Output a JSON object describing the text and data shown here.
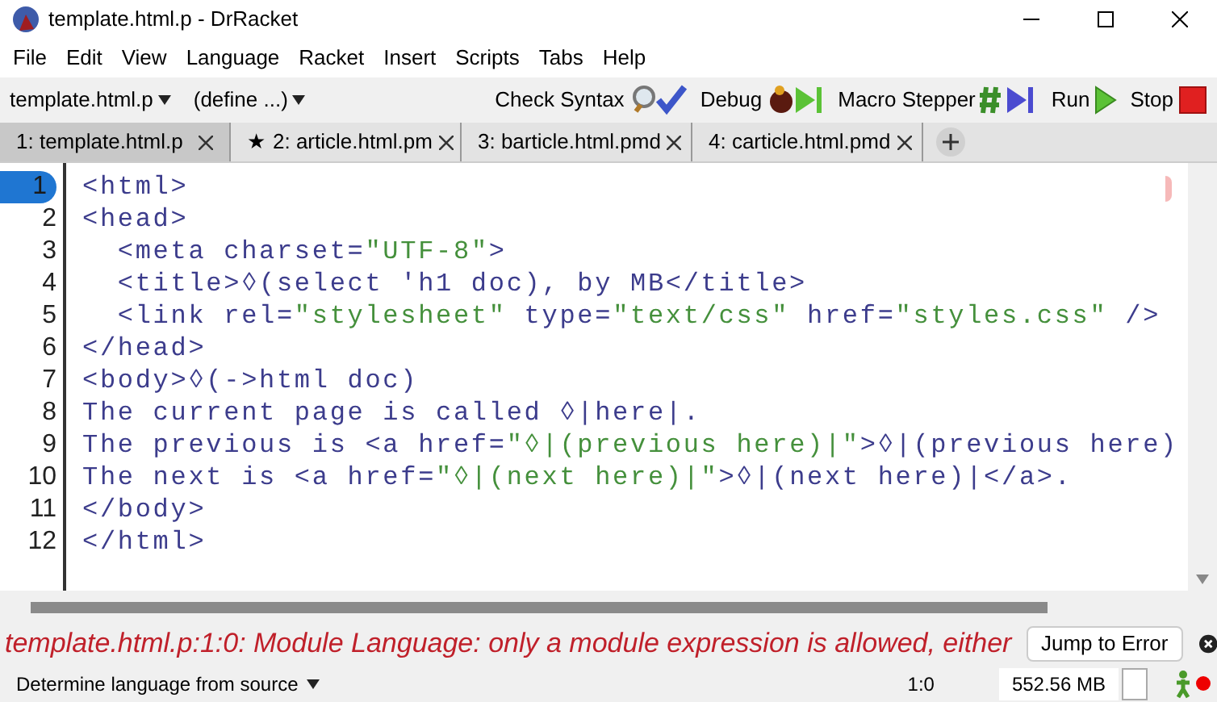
{
  "window": {
    "title": "template.html.p - DrRacket"
  },
  "menu": [
    "File",
    "Edit",
    "View",
    "Language",
    "Racket",
    "Insert",
    "Scripts",
    "Tabs",
    "Help"
  ],
  "toolbar": {
    "file_menu": "template.html.p",
    "define_menu": "(define ...)",
    "buttons": [
      {
        "label": "Check Syntax",
        "kind": "check"
      },
      {
        "label": "Debug",
        "kind": "debug"
      },
      {
        "label": "Macro Stepper",
        "kind": "macro"
      },
      {
        "label": "Run",
        "kind": "run"
      },
      {
        "label": "Stop",
        "kind": "stop"
      }
    ]
  },
  "tabs": [
    {
      "label": "1: template.html.p",
      "selected": true,
      "starred": false
    },
    {
      "label": "2: article.html.pm",
      "selected": false,
      "starred": true,
      "star": "★"
    },
    {
      "label": "3: barticle.html.pmd",
      "selected": false,
      "starred": false
    },
    {
      "label": "4: carticle.html.pmd",
      "selected": false,
      "starred": false
    }
  ],
  "editor": {
    "lines": [
      {
        "number": "1",
        "selected": true,
        "segments": [
          {
            "kind": "code",
            "text": "<html>"
          }
        ]
      },
      {
        "number": "2",
        "selected": false,
        "segments": [
          {
            "kind": "code",
            "text": "<head>"
          }
        ]
      },
      {
        "number": "3",
        "selected": false,
        "segments": [
          {
            "kind": "code",
            "text": "  <meta charset="
          },
          {
            "kind": "string",
            "text": "\"UTF-8\""
          },
          {
            "kind": "code",
            "text": ">"
          }
        ]
      },
      {
        "number": "4",
        "selected": false,
        "segments": [
          {
            "kind": "code",
            "text": "  <title>◊(select 'h1 doc), by MB</title>"
          }
        ]
      },
      {
        "number": "5",
        "selected": false,
        "segments": [
          {
            "kind": "code",
            "text": "  <link rel="
          },
          {
            "kind": "string",
            "text": "\"stylesheet\""
          },
          {
            "kind": "code",
            "text": " type="
          },
          {
            "kind": "string",
            "text": "\"text/css\""
          },
          {
            "kind": "code",
            "text": " href="
          },
          {
            "kind": "string",
            "text": "\"styles.css\""
          },
          {
            "kind": "code",
            "text": " />"
          }
        ]
      },
      {
        "number": "6",
        "selected": false,
        "segments": [
          {
            "kind": "code",
            "text": "</head>"
          }
        ]
      },
      {
        "number": "7",
        "selected": false,
        "segments": [
          {
            "kind": "code",
            "text": "<body>◊(->html doc)"
          }
        ]
      },
      {
        "number": "8",
        "selected": false,
        "segments": [
          {
            "kind": "code",
            "text": "The current page is called ◊|here|."
          }
        ]
      },
      {
        "number": "9",
        "selected": false,
        "segments": [
          {
            "kind": "code",
            "text": "The previous is <a href="
          },
          {
            "kind": "string",
            "text": "\"◊|(previous here)|\""
          },
          {
            "kind": "code",
            "text": ">◊|(previous here)"
          }
        ]
      },
      {
        "number": "10",
        "selected": false,
        "segments": [
          {
            "kind": "code",
            "text": "The next is <a href="
          },
          {
            "kind": "string",
            "text": "\"◊|(next here)|\""
          },
          {
            "kind": "code",
            "text": ">◊|(next here)|</a>."
          }
        ]
      },
      {
        "number": "11",
        "selected": false,
        "segments": [
          {
            "kind": "code",
            "text": "</body>"
          }
        ]
      },
      {
        "number": "12",
        "selected": false,
        "segments": [
          {
            "kind": "code",
            "text": "</html>"
          }
        ]
      }
    ]
  },
  "error": {
    "message": "template.html.p:1:0: Module Language: only a module expression is allowed, either",
    "button": "Jump to Error"
  },
  "status_bar": {
    "language": "Determine language from source",
    "position": "1:0",
    "memory": "552.56 MB"
  }
}
